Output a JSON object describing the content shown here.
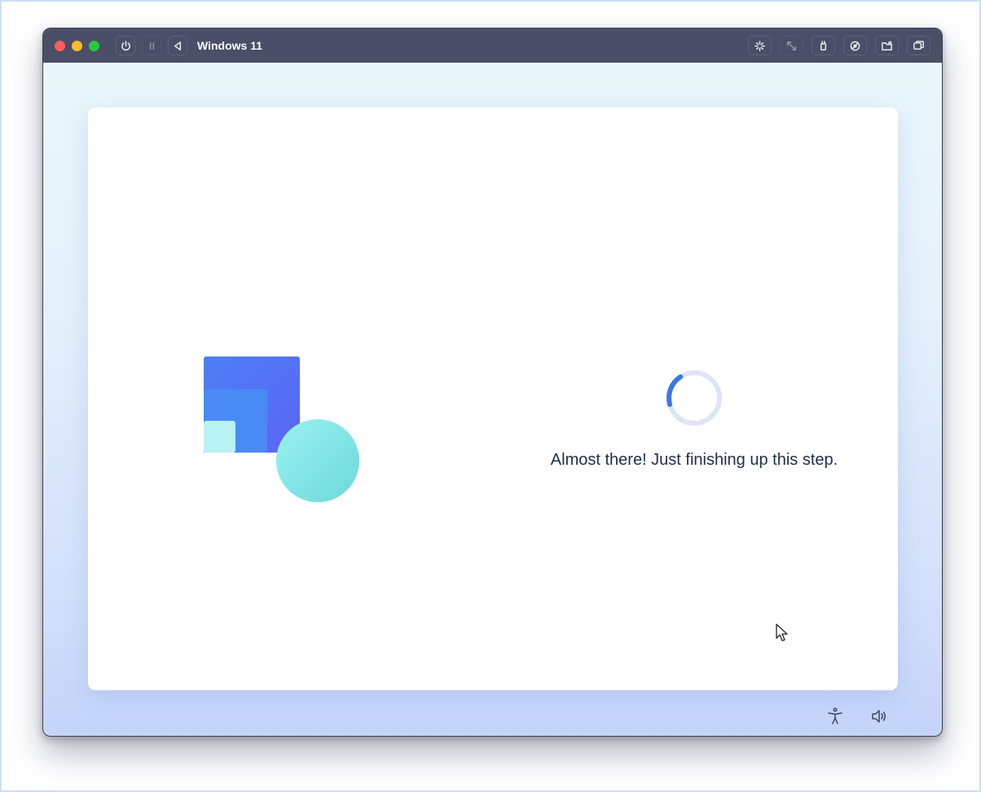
{
  "window": {
    "title": "Windows 11"
  },
  "toolbar": {
    "left_icons": [
      "power-icon",
      "pause-icon",
      "back-icon"
    ],
    "right_icons": [
      "sparkle-icon",
      "resize-icon",
      "usb-icon",
      "disc-icon",
      "shared-folder-icon",
      "snapshot-icon"
    ]
  },
  "setup": {
    "status_text": "Almost there! Just finishing up this step.",
    "spinner_progress": 0.2
  },
  "colors": {
    "titlebar": "#4a4e66",
    "accent": "#3b78e7",
    "spinner_track": "#dfe4f7",
    "text": "#1f2d4f"
  },
  "footer": {
    "icons": [
      "accessibility-icon",
      "volume-icon"
    ]
  }
}
